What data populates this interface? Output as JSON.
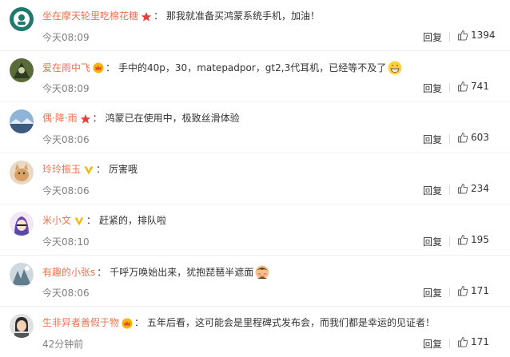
{
  "reply_label": "回复",
  "colors": {
    "username": "#eb7350",
    "text": "#333333",
    "meta": "#808080"
  },
  "comments": [
    {
      "username": "坐在摩天轮里吃棉花糖",
      "badge": "star-icon",
      "content": "那我就准备买鸿蒙系统手机，加油！",
      "emoji": "",
      "time": "今天08:09",
      "likes": "1394"
    },
    {
      "username": "爱在雨中飞",
      "badge": "crown-icon",
      "content": "手中的40p，30，matepadpor，gt2,3代耳机，已经等不及了",
      "emoji": "grin-emoji",
      "time": "今天08:09",
      "likes": "741"
    },
    {
      "username": "偶·降·雨",
      "badge": "star-icon",
      "content": "鸿蒙已在使用中，极致丝滑体验",
      "emoji": "",
      "time": "今天08:06",
      "likes": "603"
    },
    {
      "username": "玲玲振玉",
      "badge": "v-icon",
      "content": "厉害哦",
      "emoji": "",
      "time": "今天08:06",
      "likes": "234"
    },
    {
      "username": "米小文",
      "badge": "v-icon",
      "content": "赶紧的，排队啦",
      "emoji": "",
      "time": "今天08:10",
      "likes": "195"
    },
    {
      "username": "有趣的小张s",
      "badge": "",
      "content": "千呼万唤始出来，犹抱琵琶半遮面",
      "emoji": "shy-emoji",
      "time": "今天08:06",
      "likes": "171"
    },
    {
      "username": "生非异者善假于物",
      "badge": "crown-icon",
      "content": "五年后看，这可能会是里程碑式发布会，而我们都是幸运的见证者！",
      "emoji": "",
      "time": "42分钟前",
      "likes": "171"
    }
  ]
}
